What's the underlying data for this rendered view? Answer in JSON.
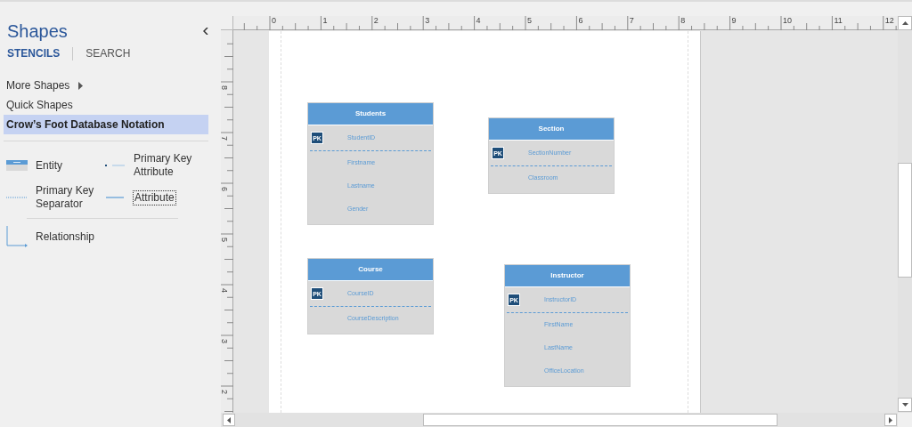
{
  "sidebar": {
    "title": "Shapes",
    "tabs": [
      {
        "label": "STENCILS",
        "selected": true
      },
      {
        "label": "SEARCH",
        "selected": false
      }
    ],
    "menu": [
      {
        "label": "More Shapes",
        "kind": "submenu",
        "selected": false
      },
      {
        "label": "Quick Shapes",
        "kind": "item",
        "selected": false
      },
      {
        "label": "Crow’s Foot Database Notation",
        "kind": "item",
        "selected": true
      }
    ],
    "shapes": [
      {
        "label": "Entity",
        "kind": "entity",
        "focused": false
      },
      {
        "label": "Primary Key Attribute",
        "kind": "pk-attribute",
        "focused": false
      },
      {
        "label": "Primary Key Separator",
        "kind": "separator",
        "focused": false
      },
      {
        "label": "Attribute",
        "kind": "attribute",
        "focused": true
      },
      {
        "label": "Relationship",
        "kind": "relationship",
        "focused": false
      }
    ]
  },
  "ruler": {
    "horizontal": [
      "0",
      "1",
      "2",
      "3",
      "4",
      "5",
      "6",
      "7",
      "8",
      "9",
      "10",
      "11",
      "12"
    ],
    "vertical": [
      "8",
      "7",
      "6",
      "5",
      "4",
      "3",
      "2"
    ]
  },
  "entities": [
    {
      "name": "Students",
      "attributes": [
        {
          "name": "StudentID",
          "kind": "pk",
          "badge": "PK"
        },
        {
          "name": "Firstname",
          "kind": "field"
        },
        {
          "name": "Lastname",
          "kind": "field"
        },
        {
          "name": "Gender",
          "kind": "field"
        }
      ]
    },
    {
      "name": "Section",
      "attributes": [
        {
          "name": "SectionNumber",
          "kind": "pk",
          "badge": "PK"
        },
        {
          "name": "Classroom",
          "kind": "field"
        }
      ]
    },
    {
      "name": "Course",
      "attributes": [
        {
          "name": "CourseID",
          "kind": "pk",
          "badge": "PK"
        },
        {
          "name": "CourseDescription",
          "kind": "field"
        }
      ]
    },
    {
      "name": "Instructor",
      "attributes": [
        {
          "name": "InstructorID",
          "kind": "pk",
          "badge": "PK"
        },
        {
          "name": "FirstName",
          "kind": "field"
        },
        {
          "name": "LastName",
          "kind": "field"
        },
        {
          "name": "OfficeLocation",
          "kind": "field"
        }
      ]
    }
  ]
}
